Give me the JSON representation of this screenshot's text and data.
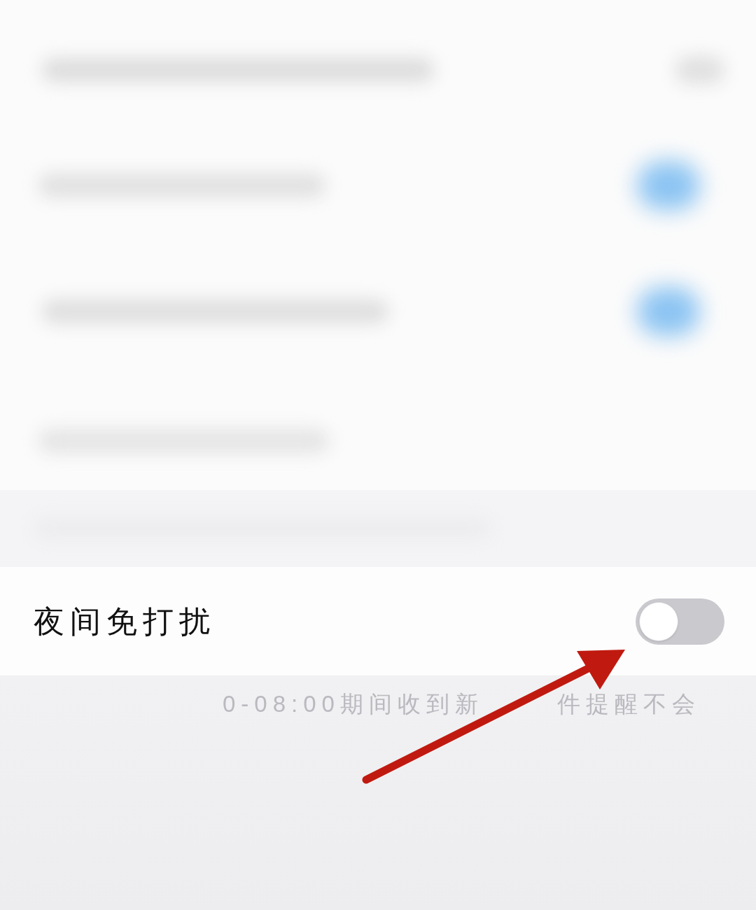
{
  "blurred_rows": [
    {
      "kind": "value"
    },
    {
      "kind": "switch",
      "on": true
    },
    {
      "kind": "switch",
      "on": true
    },
    {
      "kind": "plain"
    }
  ],
  "settings": [
    {
      "label": "夜间免打扰",
      "kind": "switch",
      "on": false
    }
  ],
  "footnote_fragments": [
    "0-08:00期间收到新",
    "件提醒不会"
  ]
}
